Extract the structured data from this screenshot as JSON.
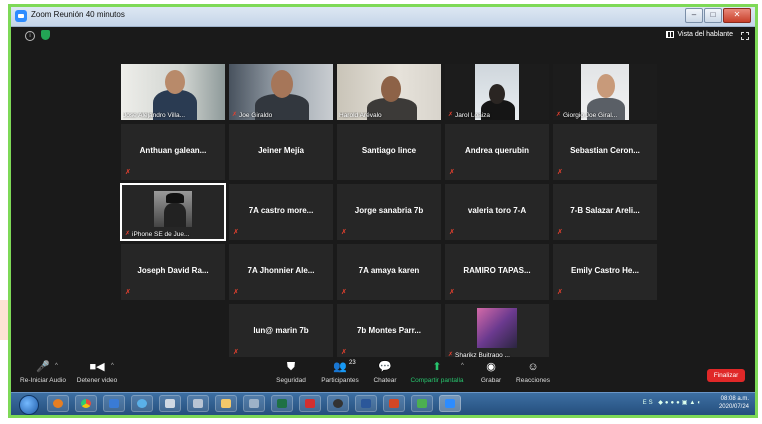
{
  "window": {
    "title": "Zoom Reunión 40 minutos"
  },
  "topbar": {
    "speaker_view": "Vista del hablante"
  },
  "participants_video": [
    {
      "name": "Jose Alejandro Villa..."
    },
    {
      "name": "Joe Giraldo"
    },
    {
      "name": "Harold Arévalo"
    },
    {
      "name": "Jarol Loaiza"
    },
    {
      "name": "Giorgio Joe Giral..."
    }
  ],
  "participants_rows": [
    [
      "Anthuan galean...",
      "Jeiner Mejía",
      "Santiago lince",
      "Andrea querubin",
      "Sebastian Ceron..."
    ],
    [
      "iPhone SE de Jue...",
      "7A castro more...",
      "Jorge sanabria 7b",
      "valeria toro 7-A",
      "7-B Salazar Areli..."
    ],
    [
      "Joseph David Ra...",
      "7A Jhonnier Ale...",
      "7A amaya karen",
      "RAMIRO TAPAS...",
      "Emily Castro He..."
    ],
    [
      "lun@ marin 7b",
      "7b Montes Parr...",
      "Sharikz Buitrago ..."
    ]
  ],
  "toolbar": {
    "audio": "Re-Iniciar Audio",
    "video": "Detener video",
    "security": "Seguridad",
    "participants": "Participantes",
    "participants_count": "23",
    "chat": "Chatear",
    "share": "Compartir pantalla",
    "record": "Grabar",
    "reactions": "Reacciones",
    "end": "Finalizar"
  },
  "taskbar": {
    "tray_lang": "ES",
    "time": "08:08 a.m.",
    "date": "2020/07/24"
  },
  "colors": {
    "accent_green": "#27c46d",
    "end_red": "#e02828",
    "frame_green": "#7ed957"
  }
}
